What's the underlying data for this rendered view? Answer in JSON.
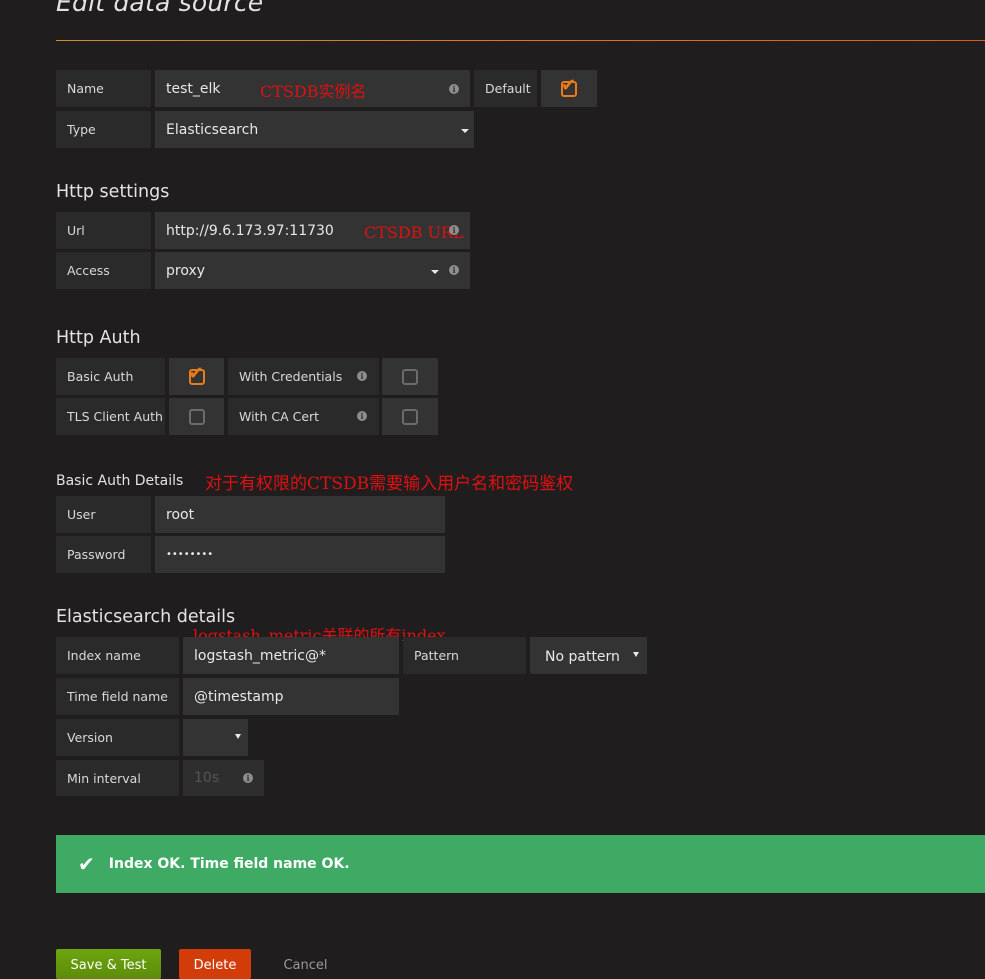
{
  "page": {
    "title": "Edit data source"
  },
  "general": {
    "name_label": "Name",
    "name_value": "test_elk",
    "name_annotation": "CTSDB实例名",
    "default_label": "Default",
    "default_checked": true,
    "type_label": "Type",
    "type_value": "Elasticsearch"
  },
  "http_settings": {
    "heading": "Http settings",
    "url_label": "Url",
    "url_value": "http://9.6.173.97:11730",
    "url_annotation": "CTSDB URL",
    "access_label": "Access",
    "access_value": "proxy"
  },
  "http_auth": {
    "heading": "Http Auth",
    "basic_auth_label": "Basic Auth",
    "basic_auth_checked": true,
    "with_credentials_label": "With Credentials",
    "with_credentials_checked": false,
    "tls_client_auth_label": "TLS Client Auth",
    "tls_client_auth_checked": false,
    "with_ca_cert_label": "With CA Cert",
    "with_ca_cert_checked": false
  },
  "basic_auth_details": {
    "heading": "Basic Auth Details",
    "annotation": "对于有权限的CTSDB需要输入用户名和密码鉴权",
    "user_label": "User",
    "user_value": "root",
    "password_label": "Password",
    "password_value": "••••••••"
  },
  "es_details": {
    "heading": "Elasticsearch details",
    "annotation": "logstash_metric关联的所有index",
    "index_name_label": "Index name",
    "index_name_value": "logstash_metric@*",
    "pattern_label": "Pattern",
    "pattern_value": "No pattern",
    "time_field_label": "Time field name",
    "time_field_value": "@timestamp",
    "version_label": "Version",
    "version_value": "",
    "min_interval_label": "Min interval",
    "min_interval_placeholder": "10s"
  },
  "alert": {
    "message": "Index OK. Time field name OK.",
    "status": "success"
  },
  "actions": {
    "save_label": "Save & Test",
    "delete_label": "Delete",
    "cancel_label": "Cancel"
  },
  "icons": {
    "info": "i",
    "tick": "✔"
  }
}
